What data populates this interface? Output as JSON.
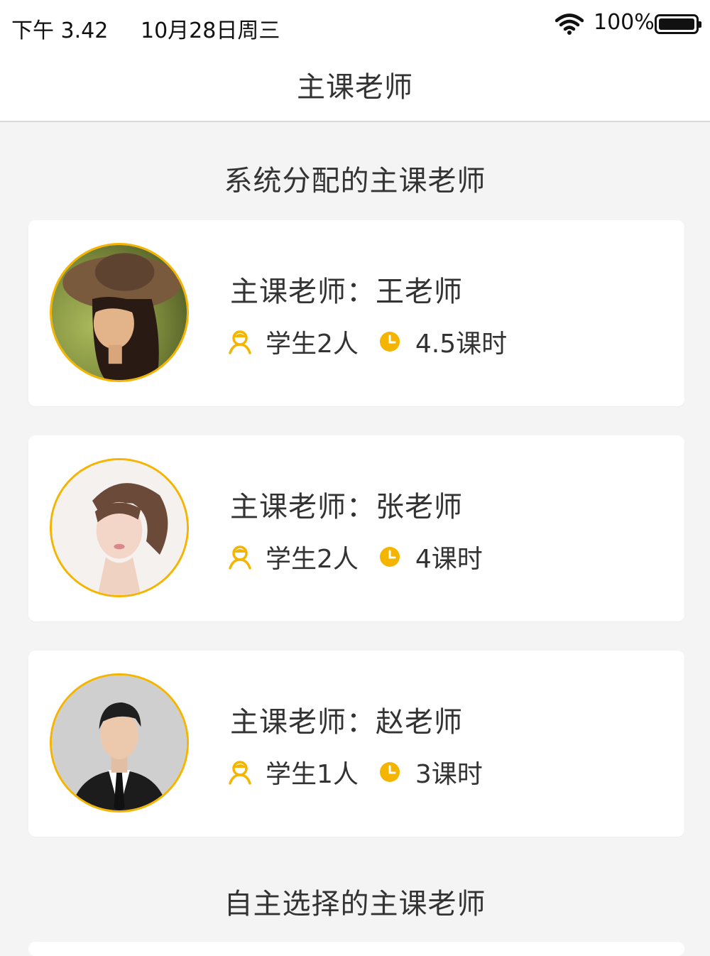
{
  "status_bar": {
    "time": "下午 3.42",
    "date": "10月28日周三",
    "battery": "100%"
  },
  "nav": {
    "title": "主课老师"
  },
  "sections": {
    "system_title": "系统分配的主课老师",
    "self_title": "自主选择的主课老师"
  },
  "teachers": [
    {
      "name": "主课老师：王老师",
      "students": "学生2人",
      "hours": "4.5课时"
    },
    {
      "name": "主课老师：张老师",
      "students": "学生2人",
      "hours": "4课时"
    },
    {
      "name": "主课老师：赵老师",
      "students": "学生1人",
      "hours": "3课时"
    }
  ],
  "colors": {
    "accent": "#f5b400",
    "background": "#f4f4f4",
    "text": "#333333"
  },
  "icons": {
    "student": "student-icon",
    "clock": "clock-icon",
    "wifi": "wifi-icon",
    "battery": "battery-icon"
  }
}
